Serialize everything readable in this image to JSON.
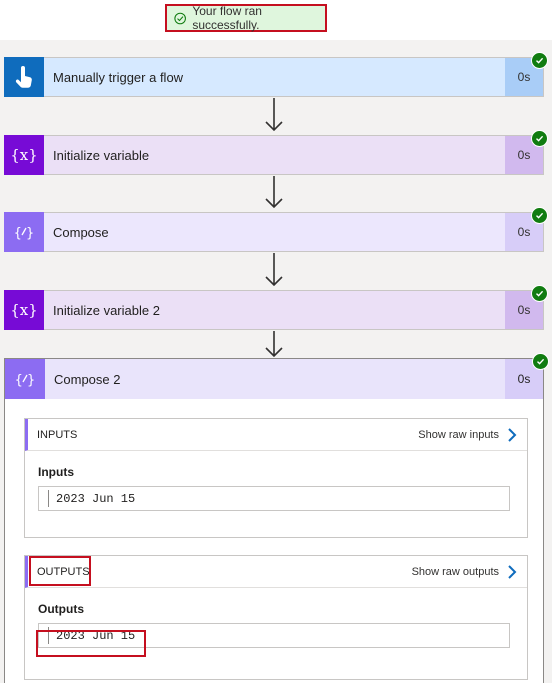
{
  "banner": {
    "text": "Your flow ran successfully."
  },
  "steps": [
    {
      "label": "Manually trigger a flow",
      "duration": "0s",
      "icon": "touch-icon",
      "bg": "#d6e9ff",
      "icon_bg": "#0f6cbd",
      "dur_bg": "#a9cdf7"
    },
    {
      "label": "Initialize variable",
      "duration": "0s",
      "icon": "variable-icon",
      "bg": "#ebe0f6",
      "icon_bg": "#770bd6",
      "dur_bg": "#d1b9ee"
    },
    {
      "label": "Compose",
      "duration": "0s",
      "icon": "compose-icon",
      "bg": "#ece7fd",
      "icon_bg": "#8c6cf2",
      "dur_bg": "#d7cdf8"
    },
    {
      "label": "Initialize variable 2",
      "duration": "0s",
      "icon": "variable-icon",
      "bg": "#ebe0f6",
      "icon_bg": "#770bd6",
      "dur_bg": "#d1b9ee"
    }
  ],
  "expanded_step": {
    "label": "Compose 2",
    "duration": "0s",
    "inputs": {
      "section_title": "INPUTS",
      "link": "Show raw inputs",
      "field_label": "Inputs",
      "field_value": "2023 Jun 15"
    },
    "outputs": {
      "section_title": "OUTPUTS",
      "link": "Show raw outputs",
      "field_label": "Outputs",
      "field_value": "2023 Jun 15"
    }
  },
  "colors": {
    "success": "#107c10",
    "highlight_box": "#c50f1f",
    "link_chevron": "#0f6cbd"
  }
}
